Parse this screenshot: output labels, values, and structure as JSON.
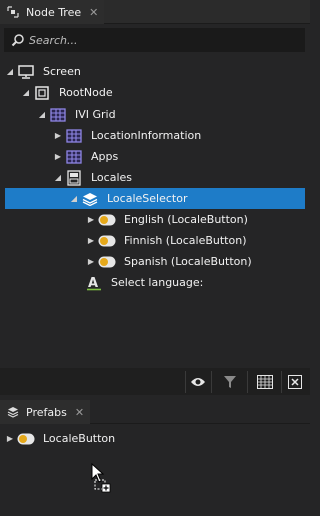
{
  "node_tree_panel": {
    "tab_title": "Node Tree",
    "tab_close": "✕",
    "search": {
      "placeholder": "Search..."
    },
    "nodes": [
      {
        "label": "Screen",
        "icon": "screen-icon",
        "expanded": true
      },
      {
        "label": "RootNode",
        "icon": "root-node-icon",
        "expanded": true
      },
      {
        "label": "IVI Grid",
        "icon": "grid-icon",
        "expanded": true
      },
      {
        "label": "LocationInformation",
        "icon": "grid-icon",
        "expanded": false
      },
      {
        "label": "Apps",
        "icon": "grid-icon",
        "expanded": false
      },
      {
        "label": "Locales",
        "icon": "stack-layout-icon",
        "expanded": true
      },
      {
        "label": "LocaleSelector",
        "icon": "component-stack-icon",
        "expanded": true,
        "selected": true
      },
      {
        "label": "English (LocaleButton)",
        "icon": "toggle-button-icon",
        "expanded": false
      },
      {
        "label": "Finnish (LocaleButton)",
        "icon": "toggle-button-icon",
        "expanded": false
      },
      {
        "label": "Spanish (LocaleButton)",
        "icon": "toggle-button-icon",
        "expanded": false
      },
      {
        "label": "Select language:",
        "icon": "text-block-icon",
        "expanded": null
      }
    ],
    "toolbar": [
      "eye-icon",
      "filter-icon",
      "checkerboard-icon",
      "fit-icon"
    ]
  },
  "prefabs_panel": {
    "tab_title": "Prefabs",
    "tab_close": "✕",
    "items": [
      {
        "label": "LocaleButton",
        "icon": "toggle-button-icon"
      }
    ]
  },
  "colors": {
    "selection": "#1e7cc8",
    "grid_icon": "#8f86e6",
    "toggle_icon": "#e5a81a"
  }
}
